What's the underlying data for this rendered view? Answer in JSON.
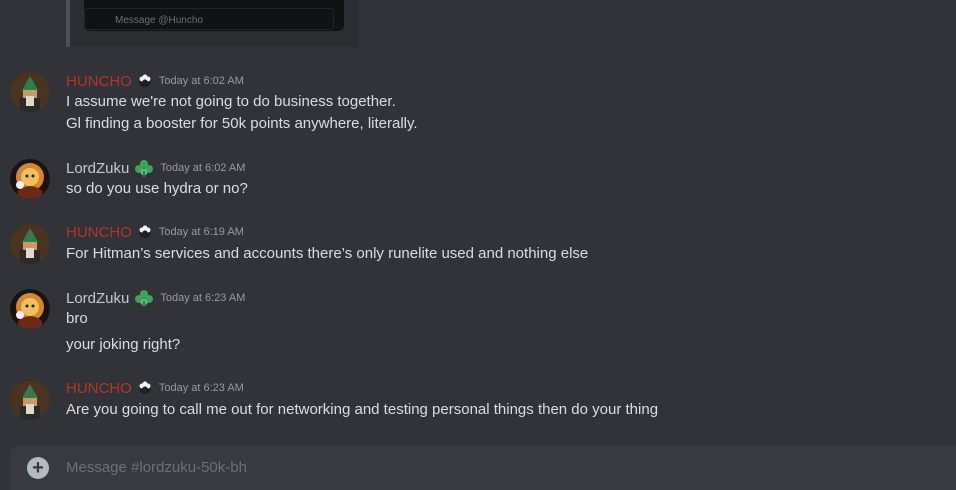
{
  "embed": {
    "message_placeholder": "Message @Huncho"
  },
  "messages": [
    {
      "author": "HUNCHO",
      "timestamp": "Today at 6:02 AM",
      "lines": [
        "I assume we're not going to do business together.",
        "Gl finding a booster for 50k points anywhere, literally."
      ]
    },
    {
      "author": "LordZuku",
      "timestamp": "Today at 6:02 AM",
      "lines": [
        "so do you use hydra or no?"
      ]
    },
    {
      "author": "HUNCHO",
      "timestamp": "Today at 6:19 AM",
      "lines": [
        "For Hitman’s services and accounts there’s only runelite used and nothing else"
      ]
    },
    {
      "author": "LordZuku",
      "timestamp": "Today at 6:23 AM",
      "lines": [
        "bro",
        "your joking right?"
      ]
    },
    {
      "author": "HUNCHO",
      "timestamp": "Today at 6:23 AM",
      "lines": [
        "Are you going to call me out for networking and testing personal things then do your thing"
      ]
    }
  ],
  "composer": {
    "placeholder": "Message #lordzuku-50k-bh"
  },
  "colors": {
    "background": "#313338",
    "huncho_name": "#b5342a",
    "lordzuku_name": "#c4c9ce",
    "composer": "#383a40"
  },
  "icons": {
    "huncho_role": "sheep-icon",
    "lordzuku_role": "clover-icon",
    "add": "plus-circle-icon"
  }
}
